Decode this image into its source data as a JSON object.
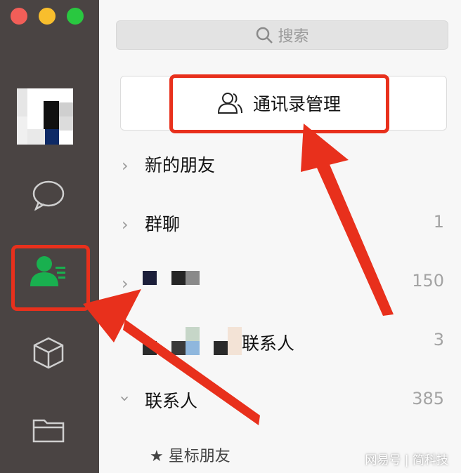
{
  "window_controls": {
    "red": "#f15e58",
    "yellow": "#f8be2d",
    "green": "#29c840"
  },
  "sidebar": {
    "active_color": "#19b04f",
    "icons": [
      "avatar",
      "chat-bubble-icon",
      "contacts-icon",
      "cube-icon",
      "folder-icon"
    ]
  },
  "search": {
    "placeholder": "搜索"
  },
  "manage_button": {
    "label": "通讯录管理"
  },
  "list": [
    {
      "label": "新的朋友",
      "count": ""
    },
    {
      "label": "群聊",
      "count": "1"
    },
    {
      "label": "",
      "count": "150"
    },
    {
      "label": "联系人",
      "count": "3"
    },
    {
      "label": "联系人",
      "count": "385"
    }
  ],
  "starred": {
    "label": "★ 星标朋友"
  },
  "watermark": "网易号 | 简科技",
  "annotation_color": "#e8301c"
}
